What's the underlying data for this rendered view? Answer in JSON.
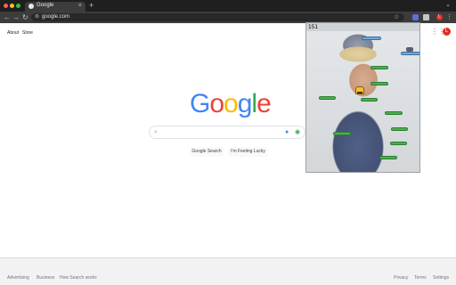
{
  "browser": {
    "tab_title": "Google",
    "tab_close": "×",
    "new_tab": "+",
    "tab_menu": "⌄",
    "url": "google.com",
    "nav": {
      "back": "←",
      "forward": "→",
      "reload": "↻"
    },
    "omni_icon": "⊜",
    "star": "☆",
    "profile_initial": "L",
    "menu": "⋮"
  },
  "page": {
    "links_left": [
      "About",
      "Store"
    ],
    "apps_icon": "⋮⋮",
    "avatar_initial": "L",
    "logo_letters": [
      {
        "ch": "G",
        "color": "#4285f4"
      },
      {
        "ch": "o",
        "color": "#ea4335"
      },
      {
        "ch": "o",
        "color": "#fbbc05"
      },
      {
        "ch": "g",
        "color": "#4285f4"
      },
      {
        "ch": "l",
        "color": "#34a853"
      },
      {
        "ch": "e",
        "color": "#ea4335"
      }
    ],
    "search_icon": "⌕",
    "mic_icon": "●",
    "lens_icon": "◉",
    "buttons": {
      "search": "Google Search",
      "lucky": "I'm Feeling Lucky"
    },
    "footer_left": [
      "Advertising",
      "Business",
      "How Search works"
    ],
    "footer_right": [
      "Privacy",
      "Terms",
      "Settings"
    ]
  },
  "game": {
    "score": "151"
  },
  "colors": {
    "chrome_dark": "#1f1f1f",
    "toolbar": "#3c3c3c",
    "platform_green": "#4caf50",
    "platform_blue": "#6fa8dc",
    "avatar_red": "#d93025"
  }
}
